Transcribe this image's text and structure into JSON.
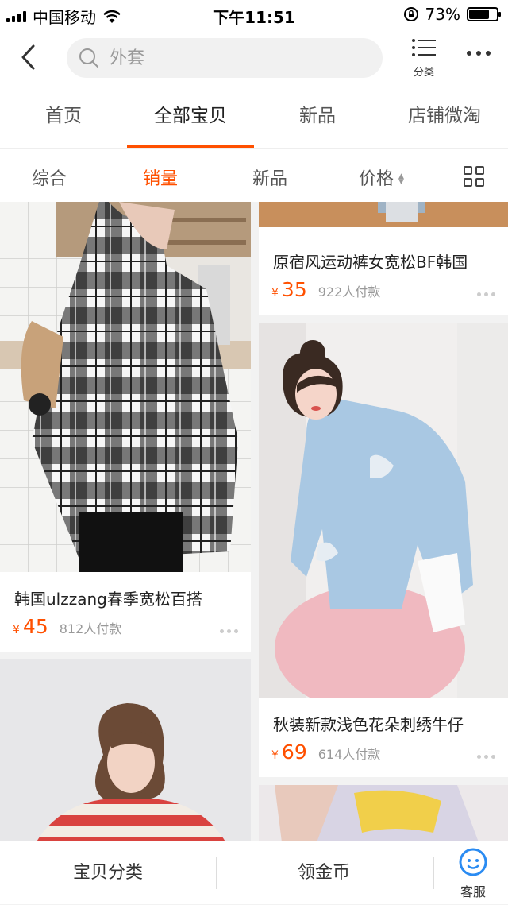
{
  "status": {
    "carrier": "中国移动",
    "time": "下午11:51",
    "battery": "73%",
    "battery_level": 0.73
  },
  "header": {
    "search_placeholder": "外套",
    "category_label": "分类",
    "icons": [
      "chevron-left-icon",
      "search-icon",
      "list-icon",
      "more-icon"
    ]
  },
  "tabs": [
    {
      "label": "首页",
      "active": false
    },
    {
      "label": "全部宝贝",
      "active": true
    },
    {
      "label": "新品",
      "active": false
    },
    {
      "label": "店铺微淘",
      "active": false
    }
  ],
  "sort": {
    "items": [
      {
        "label": "综合",
        "active": false
      },
      {
        "label": "销量",
        "active": true
      },
      {
        "label": "新品",
        "active": false
      },
      {
        "label": "价格",
        "active": false
      }
    ],
    "accent": "#ff5000"
  },
  "products": [
    {
      "title": "原宿风运动裤女宽松BF韩国",
      "currency": "¥",
      "price": "35",
      "sales": "922人付款"
    },
    {
      "title": "韩国ulzzang春季宽松百搭",
      "currency": "¥",
      "price": "45",
      "sales": "812人付款"
    },
    {
      "title": "秋装新款浅色花朵刺绣牛仔",
      "currency": "¥",
      "price": "69",
      "sales": "614人付款"
    }
  ],
  "bottom": {
    "category": "宝贝分类",
    "coins": "领金币",
    "service": "客服"
  }
}
